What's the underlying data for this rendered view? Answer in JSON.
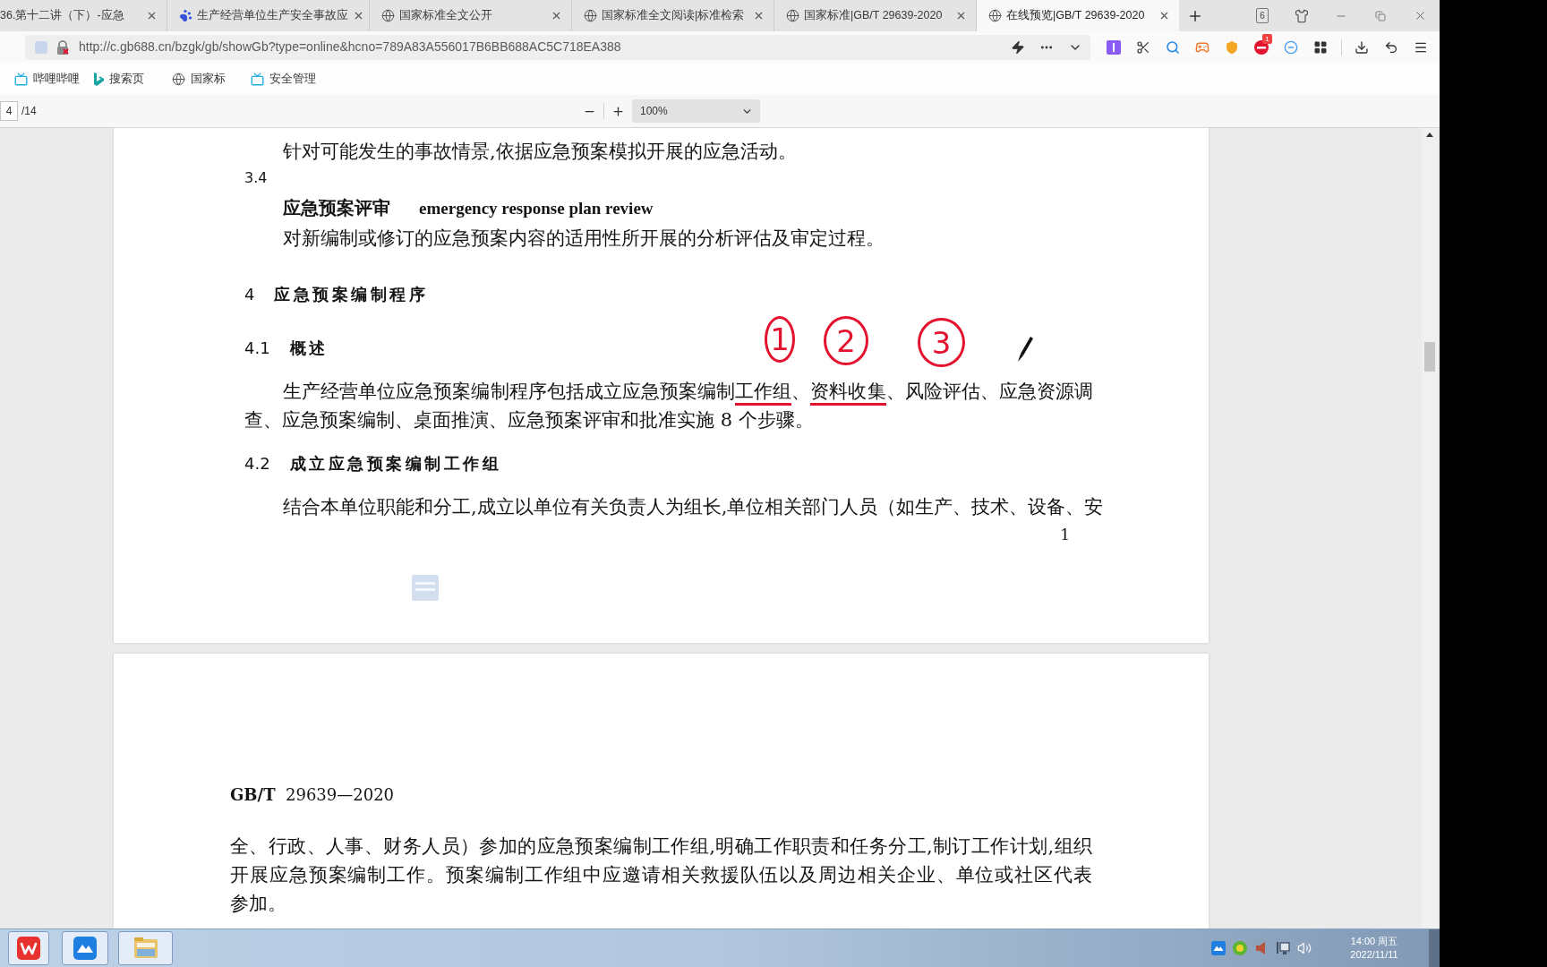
{
  "browser": {
    "tabs": [
      {
        "title": "36.第十二讲（下）-应急",
        "selected": false
      },
      {
        "title": "生产经营单位生产安全事故应",
        "selected": false
      },
      {
        "title": "国家标准全文公开",
        "selected": false
      },
      {
        "title": "国家标准全文阅读|标准检索",
        "selected": false
      },
      {
        "title": "国家标准|GB/T 29639-2020",
        "selected": false
      },
      {
        "title": "在线预览|GB/T 29639-2020",
        "selected": true
      }
    ],
    "tab_count": "6",
    "address": "http://c.gb688.cn/bzgk/gb/showGb?type=online&hcno=789A83A556017B6BB688AC5C718EA388",
    "extension_badge": "1",
    "bookmarks": [
      {
        "label": "哔哩哔哩"
      },
      {
        "label": "搜索页"
      },
      {
        "label": "国家标"
      },
      {
        "label": "安全管理"
      }
    ]
  },
  "pdf_toolbar": {
    "page": "4",
    "page_count": "/14",
    "zoom": "100%"
  },
  "upper_page": {
    "blocks": [
      {
        "kind": "body",
        "text": "针对可能发生的事故情景,依据应急预案模拟开展的应急活动。"
      },
      {
        "kind": "clause_number",
        "text": "3.4"
      },
      {
        "kind": "term",
        "term": "应急预案评审",
        "english": "emergency response plan review"
      },
      {
        "kind": "body",
        "text": "对新编制或修订的应急预案内容的适用性所开展的分析评估及审定过程。"
      },
      {
        "kind": "chapter_heading",
        "number": "4",
        "title": "应急预案编制程序"
      },
      {
        "kind": "clause_heading",
        "number": "4.1",
        "title": "概述"
      },
      {
        "kind": "marked_body",
        "segments": [
          {
            "text": "生产经营单位应急预案编制程序包括成立应急预案编制",
            "underlined": false
          },
          {
            "text": "工作组",
            "underlined": true
          },
          {
            "text": "、",
            "underlined": false
          },
          {
            "text": "资料收集",
            "underlined": true
          },
          {
            "text": "、风险评估、应急资源调查、应急预案编制、桌面推演、应急预案评审和批准实施 8 个步骤。",
            "underlined": false
          }
        ]
      },
      {
        "kind": "clause_heading",
        "number": "4.2",
        "title": "成立应急预案编制工作组"
      },
      {
        "kind": "body",
        "text": "结合本单位职能和分工,成立以单位有关负责人为组长,单位相关部门人员（如生产、技术、设备、安"
      }
    ],
    "page_number": "1",
    "annotations": [
      {
        "label": "1"
      },
      {
        "label": "2"
      },
      {
        "label": "3"
      }
    ]
  },
  "lower_page": {
    "running_header": "**GB/T**  29639—2020",
    "blocks": [
      {
        "kind": "continuation",
        "lines": [
          "全、行政、人事、财务人员）参加的应急预案编制工作组,明确工作职责和任务分工,制订工作计划,组织",
          "开展应急预案编制工作。预案编制工作组中应邀请相关救援队伍以及周边相关企业、单位或社区代表",
          "参加。"
        ]
      }
    ]
  },
  "taskbar": {
    "time": "14:00 周五",
    "date": "2022/11/11"
  }
}
